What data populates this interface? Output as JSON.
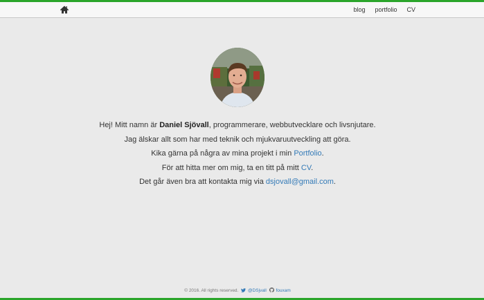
{
  "nav": {
    "home_icon": "home-icon",
    "links": [
      {
        "label": "blog"
      },
      {
        "label": "portfolio"
      },
      {
        "label": "CV"
      }
    ]
  },
  "intro": {
    "line1_pre": "Hej! Mitt namn är ",
    "line1_name": "Daniel Sjövall",
    "line1_post": ", programmerare, webbutvecklare och livsnjutare.",
    "line2": "Jag älskar allt som har med teknik och mjukvaruutveckling att göra.",
    "line3_pre": "Kika gärna på några av mina projekt i min ",
    "line3_link": "Portfolio",
    "line3_post": ".",
    "line4_pre": "För att hitta mer om mig, ta en titt på mitt ",
    "line4_link": "CV",
    "line4_post": ".",
    "line5_pre": "Det går även bra att kontakta mig via ",
    "line5_link": "dsjovall@gmail.com",
    "line5_post": "."
  },
  "footer": {
    "copyright": "© 2016. All rights reserved.",
    "twitter_icon": "twitter-icon",
    "twitter_handle": "@DSjvall",
    "github_icon": "github-icon",
    "github_handle": "fouxam"
  },
  "colors": {
    "accent_bar": "#2aa52a",
    "link": "#337ab7",
    "background": "#eaeaea"
  }
}
